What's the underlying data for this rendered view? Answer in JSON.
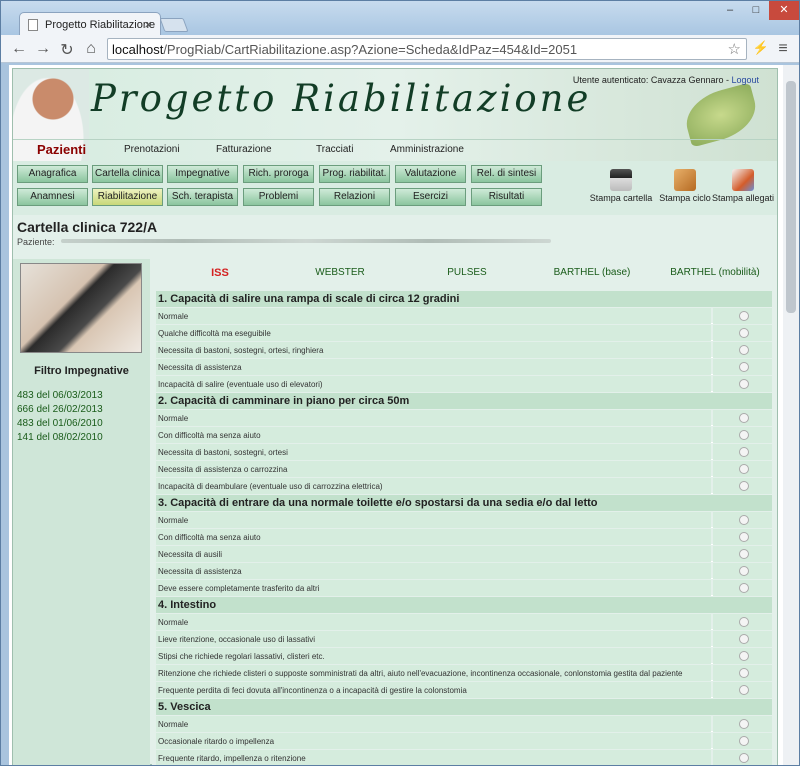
{
  "browser": {
    "tab_title": "Progetto Riabilitazione",
    "url_host": "localhost",
    "url_path": "/ProgRiab/CartRiabilitazione.asp?Azione=Scheda&IdPaz=454&Id=2051"
  },
  "header": {
    "brand": "Progetto Riabilitazione",
    "user_label": "Utente autenticato: Cavazza Gennaro - ",
    "logout": "Logout"
  },
  "main_nav": [
    "Pazienti",
    "Prenotazioni",
    "Fatturazione",
    "Tracciati",
    "Amministrazione"
  ],
  "sub_nav_row1": [
    "Anagrafica",
    "Cartella clinica",
    "Impegnative",
    "Rich. proroga",
    "Prog. riabilitat.",
    "Valutazione",
    "Rel. di sintesi"
  ],
  "sub_nav_row2": [
    "Anamnesi",
    "Riabilitazione",
    "Sch. terapista",
    "Problemi",
    "Relazioni",
    "Esercizi",
    "Risultati"
  ],
  "print_tools": [
    "Stampa cartella",
    "Stampa ciclo",
    "Stampa allegati"
  ],
  "record": {
    "title": "Cartella clinica 722/A",
    "patient_label": "Paziente:"
  },
  "filter": {
    "title": "Filtro Impegnative",
    "items": [
      "483 del 06/03/2013",
      "666 del 26/02/2013",
      "483 del 01/06/2010",
      "141 del 08/02/2010"
    ]
  },
  "scales": [
    "ISS",
    "WEBSTER",
    "PULSES",
    "BARTHEL (base)",
    "BARTHEL (mobilità)"
  ],
  "sections": [
    {
      "title": "1. Capacità di salire una rampa di scale di circa 12 gradini",
      "options": [
        "Normale",
        "Qualche difficoltà ma eseguibile",
        "Necessita di bastoni, sostegni, ortesi, ringhiera",
        "Necessita di assistenza",
        "Incapacità di salire (eventuale uso di elevatori)"
      ]
    },
    {
      "title": "2. Capacità di camminare in piano per circa 50m",
      "options": [
        "Normale",
        "Con difficoltà ma senza aiuto",
        "Necessita di bastoni, sostegni, ortesi",
        "Necessita di assistenza o carrozzina",
        "Incapacità di deambulare (eventuale uso di carrozzina elettrica)"
      ]
    },
    {
      "title": "3. Capacità di entrare da una normale toilette e/o spostarsi da una sedia e/o dal letto",
      "options": [
        "Normale",
        "Con difficoltà ma senza aiuto",
        "Necessita di ausili",
        "Necessita di assistenza",
        "Deve essere completamente trasferito da altri"
      ]
    },
    {
      "title": "4. Intestino",
      "options": [
        "Normale",
        "Lieve ritenzione, occasionale uso di lassativi",
        "Stipsi che richiede regolari lassativi, clisteri etc.",
        "Ritenzione che richiede clisteri o supposte somministrati da altri, aiuto nell'evacuazione, incontinenza occasionale, conlonstomia gestita dal paziente",
        "Frequente perdita di feci dovuta all'incontinenza o a incapacità di gestire la colonstomia"
      ]
    },
    {
      "title": "5. Vescica",
      "options": [
        "Normale",
        "Occasionale ritardo o impellenza",
        "Frequente ritardo, impellenza o ritenzione"
      ]
    }
  ]
}
